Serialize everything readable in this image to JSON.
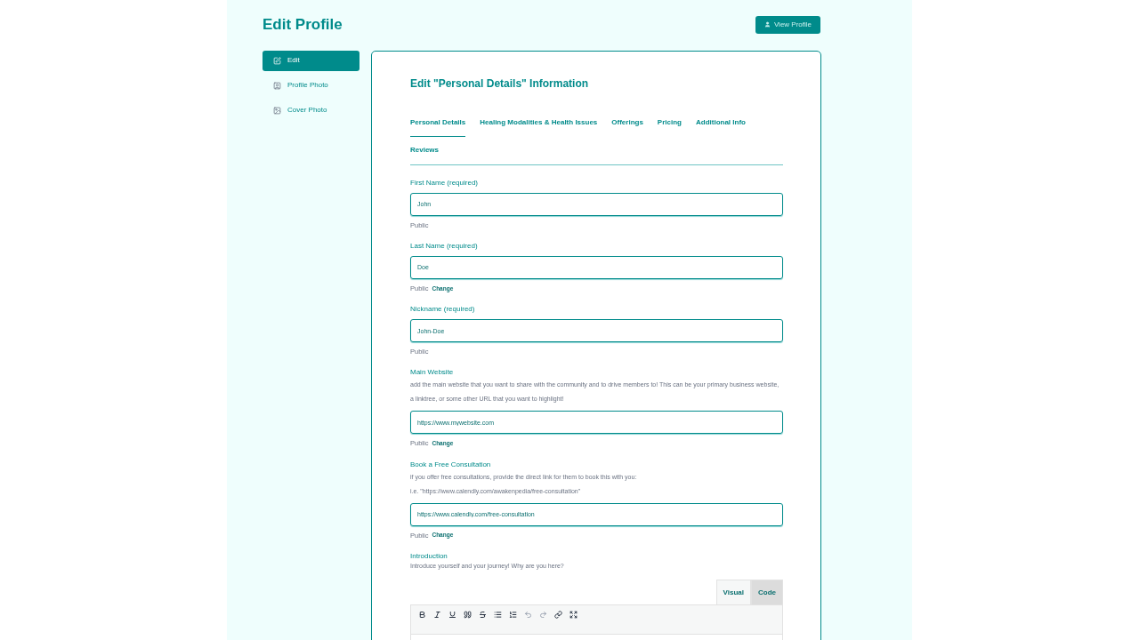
{
  "page": {
    "title": "Edit Profile",
    "view_button": "View Profile"
  },
  "sidebar": {
    "items": [
      {
        "label": "Edit",
        "kind": "edit",
        "selected": true
      },
      {
        "label": "Profile Photo",
        "kind": "profile",
        "selected": false
      },
      {
        "label": "Cover Photo",
        "kind": "cover",
        "selected": false
      }
    ]
  },
  "form": {
    "heading": "Edit \"Personal Details\" Information",
    "tabs": [
      {
        "label": "Personal Details",
        "selected": true
      },
      {
        "label": "Healing Modalities & Health Issues",
        "selected": false
      },
      {
        "label": "Offerings",
        "selected": false
      },
      {
        "label": "Pricing",
        "selected": false
      },
      {
        "label": "Additional Info",
        "selected": false
      },
      {
        "label": "Reviews",
        "selected": false
      }
    ],
    "fields": [
      {
        "label": "First Name (required)",
        "value": "John",
        "visibility": "Public"
      },
      {
        "label": "Last Name (required)",
        "value": "Doe",
        "visibility": "Public",
        "change": "Change"
      },
      {
        "label": "Nickname (required)",
        "value": "John-Doe",
        "visibility": "Public"
      },
      {
        "label": "Main Website",
        "description": [
          "add the main website that you want to share with the community and to drive members to! This can be your primary business website, a linktree, or some other URL that you want to highlight!"
        ],
        "value": "https://www.mywebsite.com",
        "visibility": "Public",
        "change": "Change"
      },
      {
        "label": "Book a Free Consultation",
        "description": [
          "if you offer free consultations, provide the direct link for them to book this with you:",
          "i.e. \"https://www.calendly.com/awakenpedia/free-consultation\""
        ],
        "value": "https://www.calendly.com/free-consultation",
        "visibility": "Public",
        "change": "Change"
      }
    ],
    "introduction": {
      "label": "Introduction",
      "description": "Introduce yourself and your journey! Why are you here?",
      "editor_tabs": [
        {
          "label": "Visual",
          "selected": true
        },
        {
          "label": "Code",
          "selected": false
        }
      ]
    }
  }
}
